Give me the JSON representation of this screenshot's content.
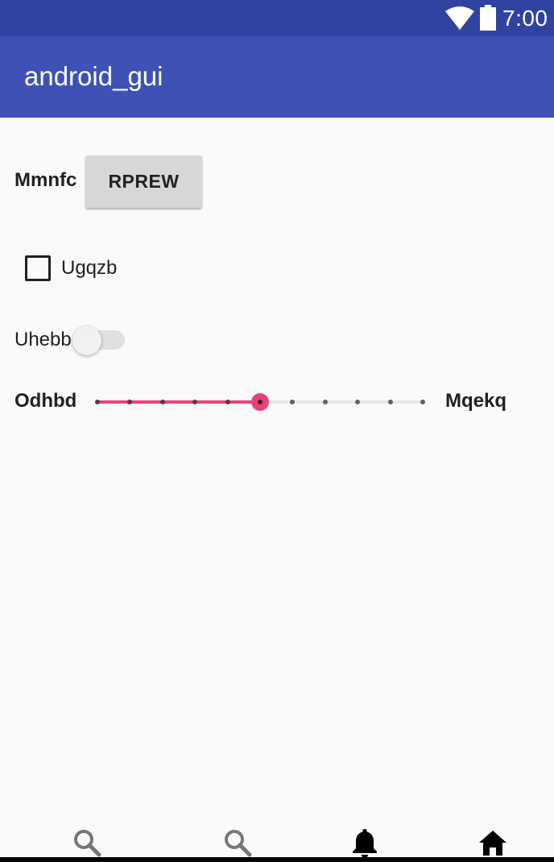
{
  "status_bar": {
    "time": "7:00",
    "icons": [
      "wifi-icon",
      "battery-icon"
    ],
    "color": "#3043a0"
  },
  "toolbar": {
    "title": "android_gui",
    "color": "#3f51b5"
  },
  "content": {
    "button_row": {
      "label": "Mmnfc",
      "button_label": "RPREW"
    },
    "checkbox": {
      "label": "Ugqzb",
      "checked": false
    },
    "switch": {
      "label": "Uhebb",
      "on": false
    },
    "slider": {
      "min_label": "Odhbd",
      "max_label": "Mqekq",
      "steps": 10,
      "value": 5,
      "accent_color": "#ec407a"
    }
  },
  "bottom_nav": {
    "items": [
      {
        "icon": "search-icon"
      },
      {
        "icon": "search-icon"
      },
      {
        "icon": "bell-icon"
      },
      {
        "icon": "home-icon"
      }
    ]
  }
}
